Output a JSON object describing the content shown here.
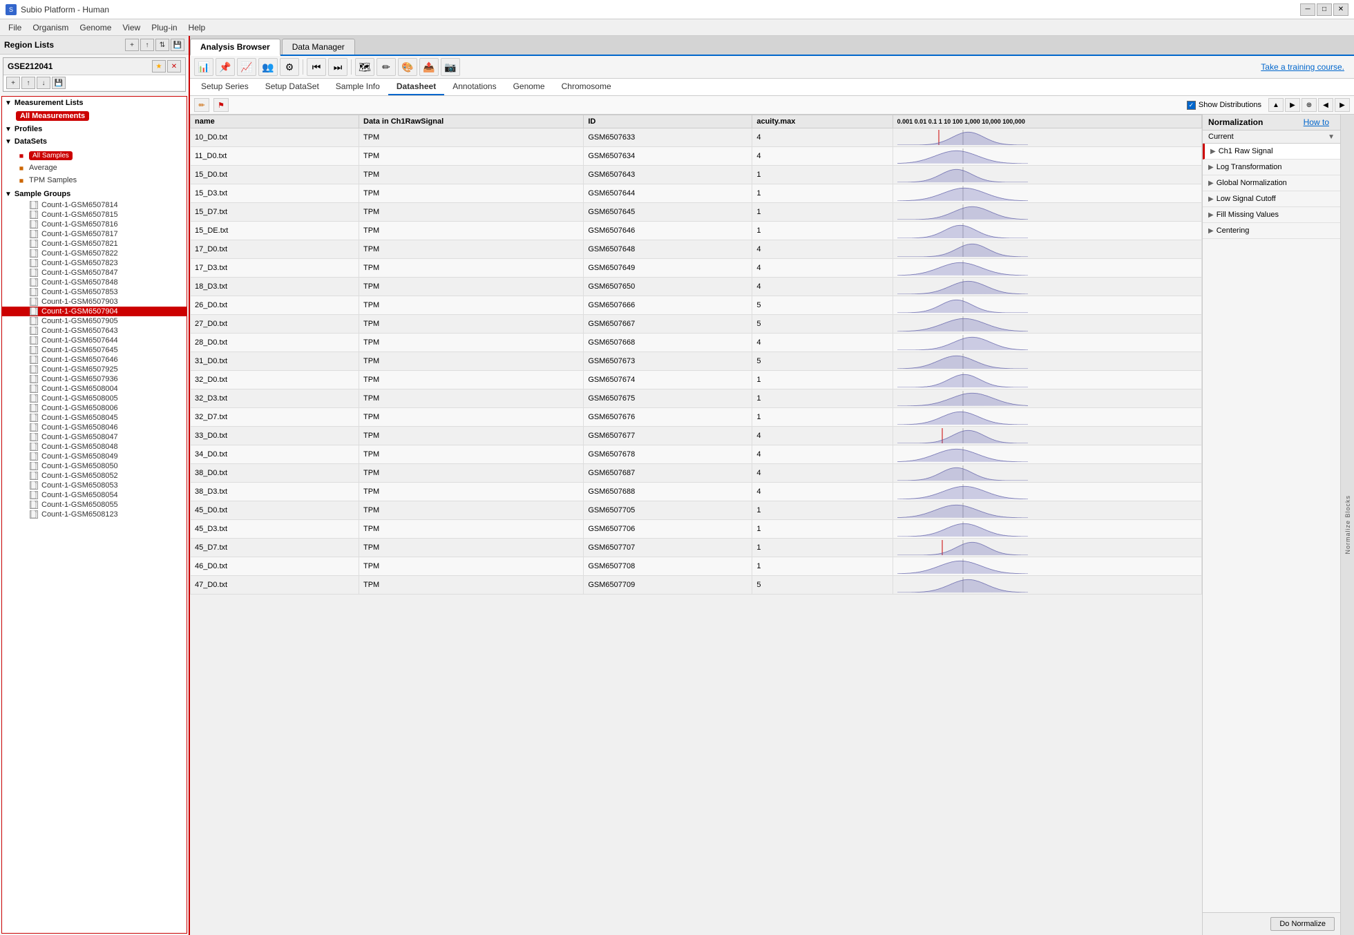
{
  "titleBar": {
    "title": "Subio Platform - Human",
    "icon": "S"
  },
  "menuBar": {
    "items": [
      "File",
      "Organism",
      "Genome",
      "View",
      "Plug-in",
      "Help"
    ]
  },
  "leftPanel": {
    "regionListsTitle": "Region Lists",
    "gseTitle": "GSE212041",
    "measurementListsLabel": "Measurement Lists",
    "allMeasurementsLabel": "All Measurements",
    "profilesLabel": "Profiles",
    "dataSetsLabel": "DataSets",
    "allSamplesLabel": "All Samples",
    "averageLabel": "Average",
    "tpmSamplesLabel": "TPM Samples",
    "sampleGroupsLabel": "Sample Groups",
    "samples": [
      "Count-1-GSM6507814",
      "Count-1-GSM6507815",
      "Count-1-GSM6507816",
      "Count-1-GSM6507817",
      "Count-1-GSM6507821",
      "Count-1-GSM6507822",
      "Count-1-GSM6507823",
      "Count-1-GSM6507847",
      "Count-1-GSM6507848",
      "Count-1-GSM6507853",
      "Count-1-GSM6507903",
      "Count-1-GSM6507904",
      "Count-1-GSM6507905",
      "Count-1-GSM6507643",
      "Count-1-GSM6507644",
      "Count-1-GSM6507645",
      "Count-1-GSM6507646",
      "Count-1-GSM6507925",
      "Count-1-GSM6507936",
      "Count-1-GSM6508004",
      "Count-1-GSM6508005",
      "Count-1-GSM6508006",
      "Count-1-GSM6508045",
      "Count-1-GSM6508046",
      "Count-1-GSM6508047",
      "Count-1-GSM6508048",
      "Count-1-GSM6508049",
      "Count-1-GSM6508050",
      "Count-1-GSM6508052",
      "Count-1-GSM6508053",
      "Count-1-GSM6508054",
      "Count-1-GSM6508055",
      "Count-1-GSM6508123"
    ],
    "selectedSample": "Count-1-GSM6507904"
  },
  "tabs": {
    "analysisBrowser": "Analysis Browser",
    "dataManager": "Data Manager"
  },
  "subTabs": {
    "items": [
      "Setup Series",
      "Setup DataSet",
      "Sample Info",
      "Datasheet",
      "Annotations",
      "Genome",
      "Chromosome"
    ]
  },
  "tableControls": {
    "showDistributions": "Show Distributions"
  },
  "tableHeaders": {
    "name": "name",
    "dataInCh1RawSignal": "Data in Ch1RawSignal",
    "id": "ID",
    "acuityMax": "acuity.max",
    "distribution": "0.001 0.01 0.1  1  10  100 1,000 10,000 100,000"
  },
  "tableRows": [
    {
      "name": "10_D0.txt",
      "data": "TPM",
      "id": "GSM6507633",
      "acuity": "4"
    },
    {
      "name": "11_D0.txt",
      "data": "TPM",
      "id": "GSM6507634",
      "acuity": "4"
    },
    {
      "name": "15_D0.txt",
      "data": "TPM",
      "id": "GSM6507643",
      "acuity": "1"
    },
    {
      "name": "15_D3.txt",
      "data": "TPM",
      "id": "GSM6507644",
      "acuity": "1"
    },
    {
      "name": "15_D7.txt",
      "data": "TPM",
      "id": "GSM6507645",
      "acuity": "1"
    },
    {
      "name": "15_DE.txt",
      "data": "TPM",
      "id": "GSM6507646",
      "acuity": "1"
    },
    {
      "name": "17_D0.txt",
      "data": "TPM",
      "id": "GSM6507648",
      "acuity": "4"
    },
    {
      "name": "17_D3.txt",
      "data": "TPM",
      "id": "GSM6507649",
      "acuity": "4"
    },
    {
      "name": "18_D3.txt",
      "data": "TPM",
      "id": "GSM6507650",
      "acuity": "4"
    },
    {
      "name": "26_D0.txt",
      "data": "TPM",
      "id": "GSM6507666",
      "acuity": "5"
    },
    {
      "name": "27_D0.txt",
      "data": "TPM",
      "id": "GSM6507667",
      "acuity": "5"
    },
    {
      "name": "28_D0.txt",
      "data": "TPM",
      "id": "GSM6507668",
      "acuity": "4"
    },
    {
      "name": "31_D0.txt",
      "data": "TPM",
      "id": "GSM6507673",
      "acuity": "5"
    },
    {
      "name": "32_D0.txt",
      "data": "TPM",
      "id": "GSM6507674",
      "acuity": "1"
    },
    {
      "name": "32_D3.txt",
      "data": "TPM",
      "id": "GSM6507675",
      "acuity": "1"
    },
    {
      "name": "32_D7.txt",
      "data": "TPM",
      "id": "GSM6507676",
      "acuity": "1"
    },
    {
      "name": "33_D0.txt",
      "data": "TPM",
      "id": "GSM6507677",
      "acuity": "4"
    },
    {
      "name": "34_D0.txt",
      "data": "TPM",
      "id": "GSM6507678",
      "acuity": "4"
    },
    {
      "name": "38_D0.txt",
      "data": "TPM",
      "id": "GSM6507687",
      "acuity": "4"
    },
    {
      "name": "38_D3.txt",
      "data": "TPM",
      "id": "GSM6507688",
      "acuity": "4"
    },
    {
      "name": "45_D0.txt",
      "data": "TPM",
      "id": "GSM6507705",
      "acuity": "1"
    },
    {
      "name": "45_D3.txt",
      "data": "TPM",
      "id": "GSM6507706",
      "acuity": "1"
    },
    {
      "name": "45_D7.txt",
      "data": "TPM",
      "id": "GSM6507707",
      "acuity": "1"
    },
    {
      "name": "46_D0.txt",
      "data": "TPM",
      "id": "GSM6507708",
      "acuity": "1"
    },
    {
      "name": "47_D0.txt",
      "data": "TPM",
      "id": "GSM6507709",
      "acuity": "5"
    }
  ],
  "normPanel": {
    "title": "Normalization",
    "howto": "How to",
    "currentLabel": "Current",
    "items": [
      {
        "label": "Ch1 Raw Signal",
        "selected": true
      },
      {
        "label": "Log Transformation",
        "selected": false
      },
      {
        "label": "Global Normalization",
        "selected": false
      },
      {
        "label": "Low Signal Cutoff",
        "selected": false
      },
      {
        "label": "Fill Missing Values",
        "selected": false
      },
      {
        "label": "Centering",
        "selected": false
      }
    ],
    "doNormalize": "Do Normalize",
    "normalizeBlocksLabel": "Normalize Blocks"
  }
}
